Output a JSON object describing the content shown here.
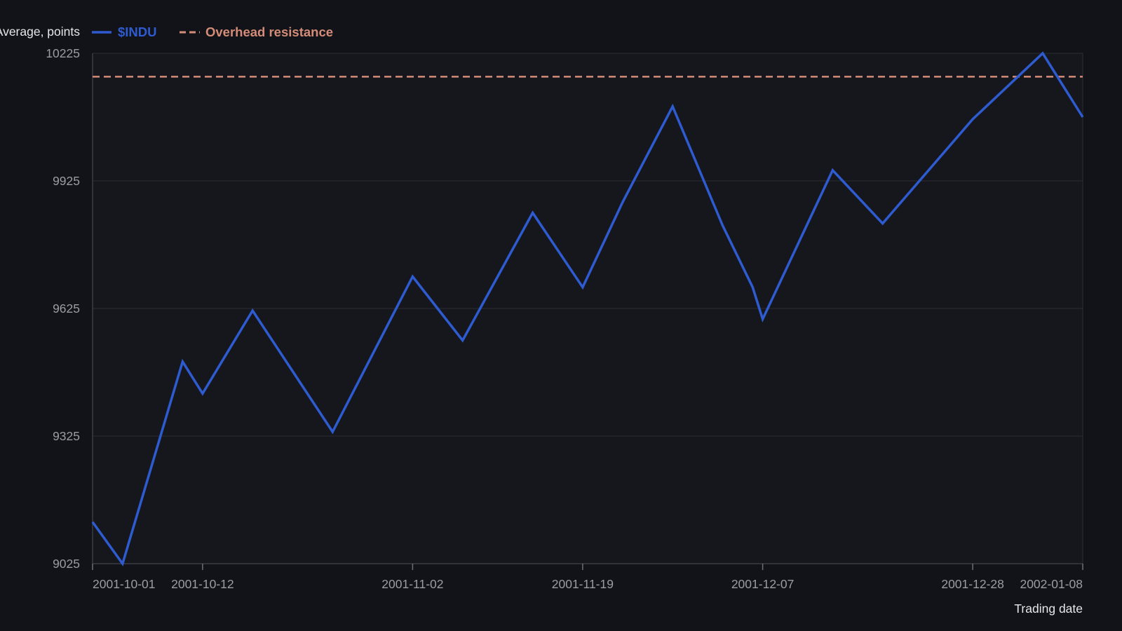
{
  "chart_data": {
    "type": "line",
    "title": "",
    "xlabel": "Trading date",
    "ylabel": "Dow Jones Industrial Average, points",
    "x": [
      "2001-10-01",
      "2001-10-04",
      "2001-10-10",
      "2001-10-12",
      "2001-10-17",
      "2001-10-25",
      "2001-11-02",
      "2001-11-07",
      "2001-11-14",
      "2001-11-19",
      "2001-11-23",
      "2001-11-28",
      "2001-12-03",
      "2001-12-06",
      "2001-12-07",
      "2001-12-14",
      "2001-12-19",
      "2001-12-28",
      "2002-01-04",
      "2002-01-08"
    ],
    "x_ticks": [
      "2001-10-01",
      "2001-10-12",
      "2001-11-02",
      "2001-11-19",
      "2001-12-07",
      "2001-12-28",
      "2002-01-08"
    ],
    "y_ticks": [
      9025,
      9325,
      9625,
      9925,
      10225
    ],
    "ylim": [
      9025,
      10225
    ],
    "grid": true,
    "legend_position": "top-left",
    "series": [
      {
        "name": "$INDU",
        "color": "#2e5bd0",
        "style": "solid",
        "values": [
          9123,
          9025,
          9500,
          9425,
          9620,
          9335,
          9700,
          9550,
          9850,
          9675,
          9875,
          10100,
          9820,
          9675,
          9600,
          9950,
          9825,
          10070,
          10225,
          10075
        ]
      },
      {
        "name": "Overhead resistance",
        "color": "#d48c78",
        "style": "dashed",
        "value": 10170
      }
    ]
  }
}
